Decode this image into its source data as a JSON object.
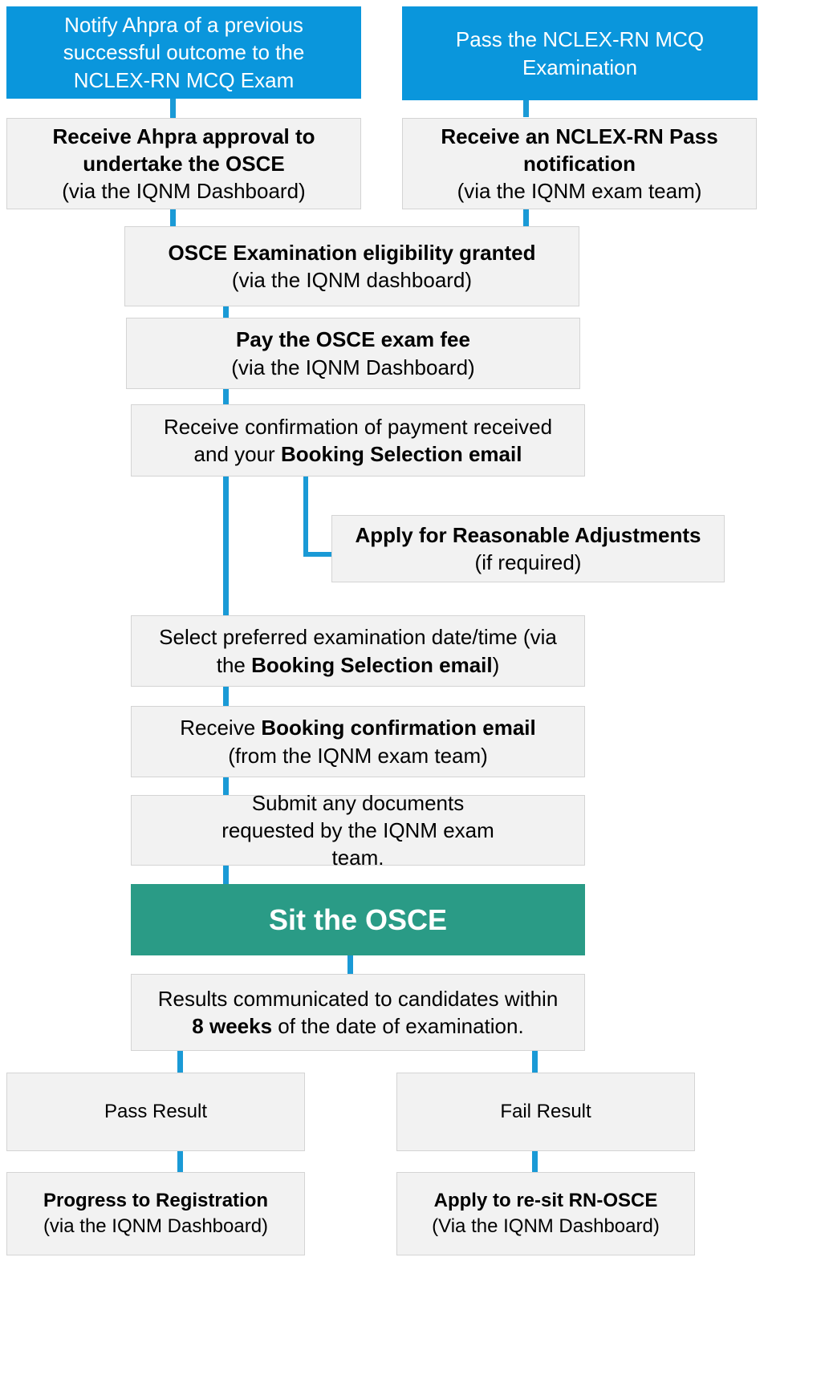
{
  "colors": {
    "accent_blue": "#0a96dc",
    "connector": "#1a9ad6",
    "success_green": "#2a9b86",
    "box_grey": "#f2f2f2"
  },
  "flow": {
    "notify_ahpra": {
      "text": "Notify Ahpra of a previous successful outcome to the NCLEX-RN MCQ Exam"
    },
    "pass_nclex": {
      "text": "Pass the NCLEX-RN MCQ Examination"
    },
    "ahpra_approval": {
      "title": "Receive Ahpra approval to undertake the OSCE",
      "sub": "(via the IQNM Dashboard)"
    },
    "nclex_pass_notification": {
      "title": "Receive an NCLEX-RN Pass notification",
      "sub": "(via the IQNM exam team)"
    },
    "eligibility": {
      "title": "OSCE Examination eligibility granted",
      "sub": "(via the IQNM dashboard)"
    },
    "pay_fee": {
      "title": "Pay the OSCE exam fee",
      "sub": "(via the IQNM Dashboard)"
    },
    "payment_confirmation": {
      "pre": "Receive confirmation of payment received",
      "pre2": "and your ",
      "bold": "Booking Selection email"
    },
    "reasonable_adjustments": {
      "title": "Apply for Reasonable Adjustments",
      "sub": "(if required)"
    },
    "select_date": {
      "pre": "Select preferred examination date/time (via",
      "pre2": "the ",
      "bold": "Booking Selection email",
      "post": ")"
    },
    "booking_confirmation": {
      "pre": "Receive ",
      "bold": "Booking confirmation email",
      "sub": "(from the IQNM exam team)"
    },
    "submit_documents": {
      "text": "Submit any documents requested by the IQNM exam team."
    },
    "sit_osce": {
      "text": "Sit the OSCE"
    },
    "results": {
      "pre": "Results communicated to candidates within",
      "bold": "8 weeks",
      "post": " of the date of examination."
    },
    "pass_result": {
      "text": "Pass Result"
    },
    "fail_result": {
      "text": "Fail Result"
    },
    "progress_registration": {
      "title": "Progress to Registration",
      "sub": "(via the IQNM Dashboard)"
    },
    "apply_resit": {
      "title": "Apply to re-sit RN-OSCE",
      "sub": "(Via the IQNM Dashboard)"
    }
  }
}
